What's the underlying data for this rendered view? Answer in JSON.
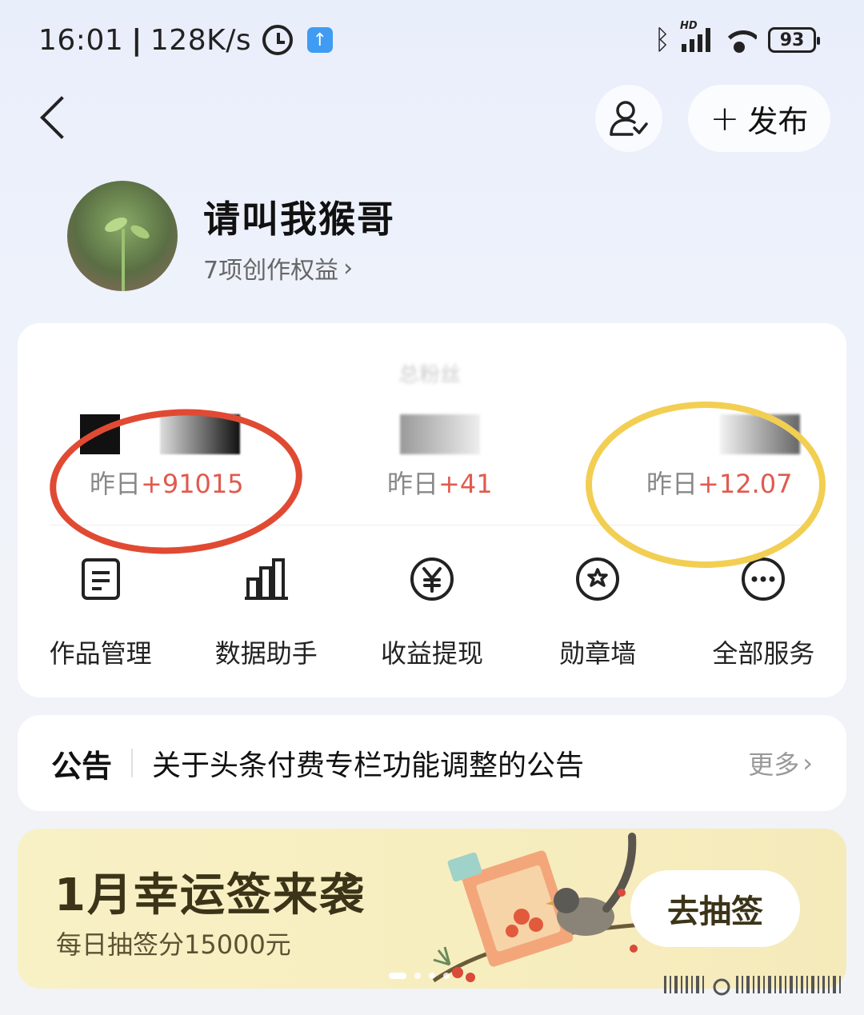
{
  "status_bar": {
    "time": "16:01",
    "separator": "|",
    "network_speed": "128K/s",
    "battery": "93",
    "signal_badge": "HD",
    "icons": [
      "alarm-icon",
      "upload-icon",
      "bluetooth-icon",
      "signal-icon",
      "wifi-icon",
      "battery-icon"
    ]
  },
  "header": {
    "publish_label": "发布"
  },
  "profile": {
    "name": "请叫我猴哥",
    "rights": "7项创作权益"
  },
  "stats": [
    {
      "label": "",
      "value_hidden": true,
      "yesterday_prefix": "昨日",
      "yesterday_delta": "+91015"
    },
    {
      "label": "总粉丝",
      "value_hidden": true,
      "yesterday_prefix": "昨日",
      "yesterday_delta": "+41"
    },
    {
      "label": "",
      "value_hidden": true,
      "yesterday_prefix": "昨日",
      "yesterday_delta": "+12.07"
    }
  ],
  "services": [
    {
      "label": "作品管理",
      "icon": "document-icon"
    },
    {
      "label": "数据助手",
      "icon": "bar-chart-icon"
    },
    {
      "label": "收益提现",
      "icon": "yuan-icon"
    },
    {
      "label": "勋章墙",
      "icon": "badge-icon"
    },
    {
      "label": "全部服务",
      "icon": "more-icon"
    }
  ],
  "notice": {
    "title": "公告",
    "text": "关于头条付费专栏功能调整的公告",
    "more": "更多"
  },
  "banner": {
    "title": "1月幸运签来袭",
    "subtitle": "每日抽签分15000元",
    "button": "去抽签",
    "page_count": 4,
    "active_page": 1
  },
  "colors": {
    "delta_red": "#e05a4e",
    "annotation_red": "#e04a33",
    "annotation_yellow": "#f2cf53",
    "banner_bg": "#f8f1c6"
  }
}
